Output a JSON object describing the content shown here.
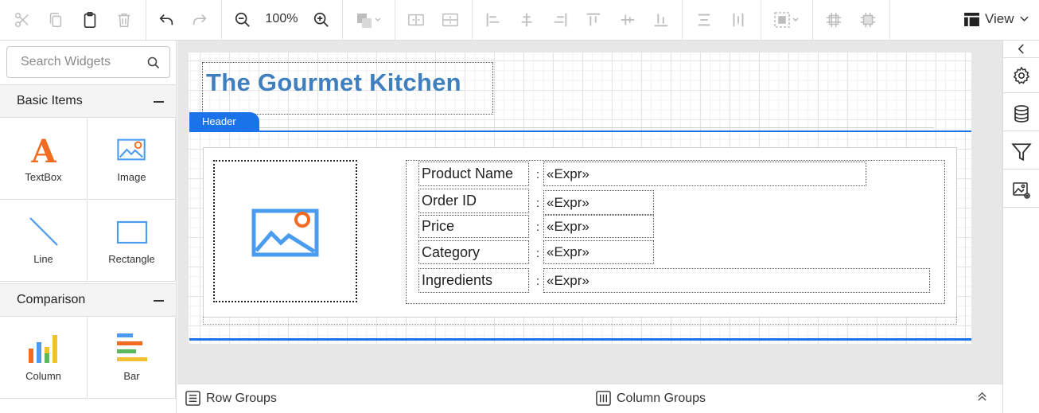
{
  "toolbar": {
    "zoom": "100%",
    "view_label": "View",
    "icons": [
      "cut-icon",
      "copy-icon",
      "paste-icon",
      "delete-icon",
      "undo-icon",
      "redo-icon",
      "zoom-out-icon",
      "zoom-in-icon",
      "fill-color-icon",
      "hsplit-icon",
      "vsplit-icon",
      "align-left-icon",
      "align-center-icon",
      "align-right-icon",
      "align-top-icon",
      "align-middle-icon",
      "align-bottom-icon",
      "distribute-horizontal-icon",
      "distribute-vertical-icon",
      "group-select-icon",
      "size-fit-icon",
      "size-fill-icon",
      "view-layout-icon"
    ]
  },
  "left_panel": {
    "search_placeholder": "Search Widgets",
    "groups": [
      {
        "title": "Basic Items",
        "items": [
          "TextBox",
          "Image",
          "Line",
          "Rectangle"
        ]
      },
      {
        "title": "Comparison",
        "items": [
          "Column",
          "Bar"
        ]
      }
    ]
  },
  "report": {
    "title": "The Gourmet Kitchen",
    "header_tab": "Header",
    "rows": [
      {
        "label": "Product Name",
        "value": "«Expr»"
      },
      {
        "label": "Order ID",
        "value": "«Expr»"
      },
      {
        "label": "Price",
        "value": "«Expr»"
      },
      {
        "label": "Category",
        "value": "«Expr»"
      },
      {
        "label": "Ingredients",
        "value": "«Expr»"
      }
    ],
    "colon": ":"
  },
  "right_panel": {
    "icons": [
      "collapse-arrow-icon",
      "settings-gear-icon",
      "database-icon",
      "filter-icon",
      "image-settings-icon"
    ]
  },
  "bottom_bar": {
    "row_groups": "Row Groups",
    "column_groups": "Column Groups"
  },
  "colors": {
    "accent": "#1a73e8",
    "title": "#3f7fbf"
  }
}
